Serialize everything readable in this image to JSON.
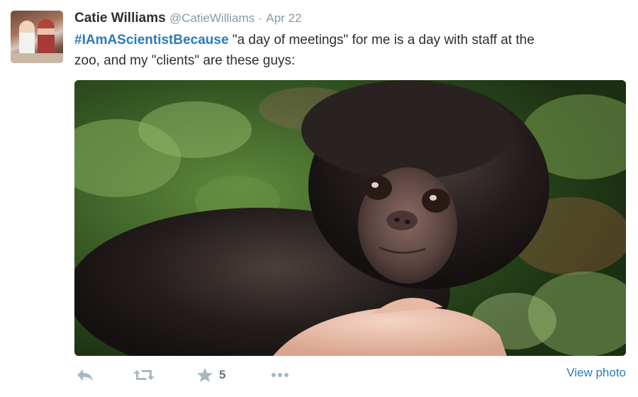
{
  "tweet": {
    "author_name": "Catie Williams",
    "author_handle": "@CatieWilliams",
    "separator": "·",
    "date": "Apr 22",
    "hashtag": "#IAmAScientistBecause",
    "text_line1": " \"a day of meetings\" for me is a day with staff at the",
    "text_line2": "zoo, and my \"clients\" are these guys:"
  },
  "actions": {
    "reply_icon": "reply-icon",
    "retweet_icon": "retweet-icon",
    "favorite_icon": "star-icon",
    "favorite_count": "5",
    "more_icon": "ellipsis-icon",
    "view_photo": "View photo"
  },
  "colors": {
    "link": "#2b7bb9",
    "muted": "#8899a6",
    "action_icon": "#aab8c2",
    "text": "#292f33"
  }
}
